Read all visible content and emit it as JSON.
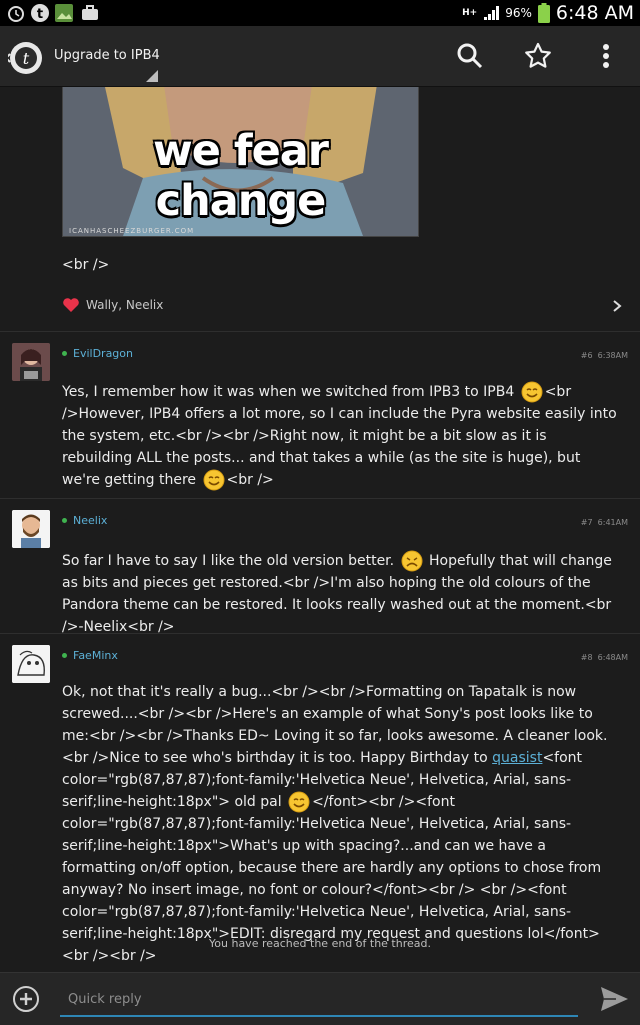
{
  "status_bar": {
    "time": "6:48 AM",
    "battery": "96%",
    "network": "H+"
  },
  "app_bar": {
    "title": "Upgrade to IPB4",
    "icons": [
      "search-icon",
      "star-icon",
      "overflow-menu-icon"
    ]
  },
  "previous_post": {
    "image_caption": "we fear change",
    "image_credit": "ICANHASCHEEZBURGER.COM",
    "trailing_text": "<br />",
    "likes": "Wally, Neelix"
  },
  "posts": [
    {
      "author": "EvilDragon",
      "number": "#6",
      "time": "6:38AM",
      "text_parts": [
        "Yes, I remember how it was when we switched from IPB3 to IPB4 ",
        "<br />However, IPB4 offers a lot more, so I can include the Pyra website easily into the system, etc.<br /><br />Right now, it might be a bit slow as it is rebuilding ALL the posts... and that takes a while (as the site is huge), but we're getting there ",
        "<br />"
      ]
    },
    {
      "author": "Neelix",
      "number": "#7",
      "time": "6:41AM",
      "text_parts": [
        "So far I have to say I like the old version better. ",
        " Hopefully that will change as bits and pieces get restored.<br />I'm also hoping the old colours of the Pandora theme can be restored.  It looks really washed out at the moment.<br />-Neelix<br />"
      ]
    },
    {
      "author": "FaeMinx",
      "number": "#8",
      "time": "6:48AM",
      "text_parts": [
        "Ok, not that it's really a bug...<br /><br />Formatting on Tapatalk is now screwed....<br /><br />Here's an example of what Sony's post looks like to me:<br /><br />Thanks ED~ Loving it so far, looks awesome. A cleaner look.<br />Nice to see who's birthday it is too. Happy Birthday to ",
        "quasist",
        "<font color=\"rgb(87,87,87);font-family:'Helvetica Neue', Helvetica, Arial, sans-serif;line-height:18px\"> old pal ",
        "</font><br /><font color=\"rgb(87,87,87);font-family:'Helvetica Neue', Helvetica, Arial, sans-serif;line-height:18px\">What's up with spacing?...and can we have a formatting on/off option, because there are hardly any options to chose from anyway? No insert image, no font or colour?</font><br /> <br /><font color=\"rgb(87,87,87);font-family:'Helvetica Neue', Helvetica, Arial, sans-serif;line-height:18px\">EDIT: disregard my request and questions lol</font><br /><br />"
      ]
    }
  ],
  "end_note": "You have reached the end of the thread.",
  "quick_reply": {
    "placeholder": "Quick reply"
  },
  "colors": {
    "accent": "#2e86b5",
    "link": "#5cb0d6",
    "online": "#3fb34f",
    "background": "#1c1c1c"
  }
}
